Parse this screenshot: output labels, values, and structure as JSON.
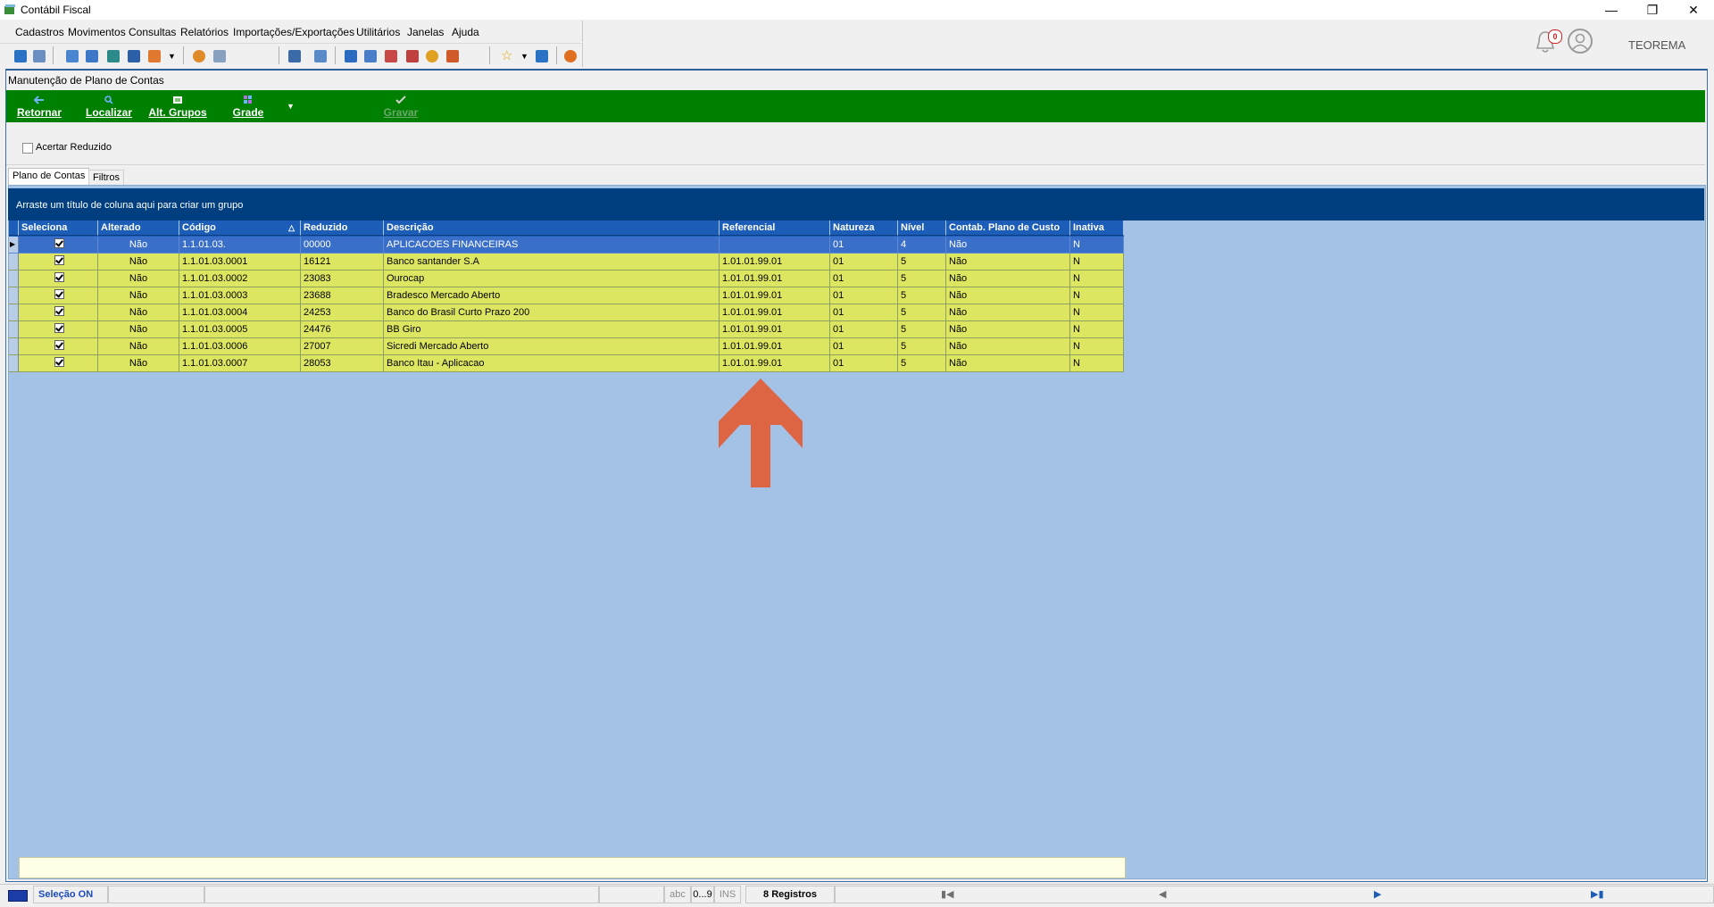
{
  "window": {
    "title": "Contábil Fiscal"
  },
  "menu": [
    "Cadastros",
    "Movimentos",
    "Consultas",
    "Relatórios",
    "Importações/Exportações",
    "Utilitários",
    "Janelas",
    "Ajuda"
  ],
  "notifications": {
    "count": "0"
  },
  "user": {
    "name": "TEOREMA"
  },
  "form": {
    "title": "Manutenção de Plano de Contas",
    "actions": {
      "retornar": "Retornar",
      "localizar": "Localizar",
      "alt_grupos": "Alt. Grupos",
      "grade": "Grade",
      "gravar": "Gravar"
    },
    "checkbox_label": "Acertar Reduzido",
    "tabs": [
      "Plano de Contas",
      "Filtros"
    ]
  },
  "grid": {
    "group_hint": "Arraste um título de coluna aqui para criar um grupo",
    "columns": [
      "Seleciona",
      "Alterado",
      "Código",
      "Reduzido",
      "Descrição",
      "Referencial",
      "Natureza",
      "Nível",
      "Contab. Plano de Custo",
      "Inativa"
    ],
    "rows": [
      {
        "alterado": "Não",
        "codigo": "1.1.01.03.",
        "reduzido": "00000",
        "descricao": "APLICACOES FINANCEIRAS",
        "referencial": "",
        "natureza": "01",
        "nivel": "4",
        "contab": "Não",
        "inativa": "N"
      },
      {
        "alterado": "Não",
        "codigo": "1.1.01.03.0001",
        "reduzido": "16121",
        "descricao": "Banco santander S.A",
        "referencial": "1.01.01.99.01",
        "natureza": "01",
        "nivel": "5",
        "contab": "Não",
        "inativa": "N"
      },
      {
        "alterado": "Não",
        "codigo": "1.1.01.03.0002",
        "reduzido": "23083",
        "descricao": "Ourocap",
        "referencial": "1.01.01.99.01",
        "natureza": "01",
        "nivel": "5",
        "contab": "Não",
        "inativa": "N"
      },
      {
        "alterado": "Não",
        "codigo": "1.1.01.03.0003",
        "reduzido": "23688",
        "descricao": "Bradesco Mercado Aberto",
        "referencial": "1.01.01.99.01",
        "natureza": "01",
        "nivel": "5",
        "contab": "Não",
        "inativa": "N"
      },
      {
        "alterado": "Não",
        "codigo": "1.1.01.03.0004",
        "reduzido": "24253",
        "descricao": "Banco do Brasil Curto Prazo 200",
        "referencial": "1.01.01.99.01",
        "natureza": "01",
        "nivel": "5",
        "contab": "Não",
        "inativa": "N"
      },
      {
        "alterado": "Não",
        "codigo": "1.1.01.03.0005",
        "reduzido": "24476",
        "descricao": "BB Giro",
        "referencial": "1.01.01.99.01",
        "natureza": "01",
        "nivel": "5",
        "contab": "Não",
        "inativa": "N"
      },
      {
        "alterado": "Não",
        "codigo": "1.1.01.03.0006",
        "reduzido": "27007",
        "descricao": "Sicredi  Mercado Aberto",
        "referencial": "1.01.01.99.01",
        "natureza": "01",
        "nivel": "5",
        "contab": "Não",
        "inativa": "N"
      },
      {
        "alterado": "Não",
        "codigo": "1.1.01.03.0007",
        "reduzido": "28053",
        "descricao": "Banco Itau - Aplicacao",
        "referencial": "1.01.01.99.01",
        "natureza": "01",
        "nivel": "5",
        "contab": "Não",
        "inativa": "N"
      }
    ]
  },
  "status": {
    "selecao": "Seleção ON",
    "abc": "abc",
    "digits": "0...9",
    "ins": "INS",
    "registros": "8 Registros"
  },
  "colors": {
    "accent_green": "#008000",
    "grid_header": "#1c5db8",
    "selected_row": "#3a6fc9",
    "row_yellow": "#dde661",
    "annotation_arrow": "#de6544"
  }
}
